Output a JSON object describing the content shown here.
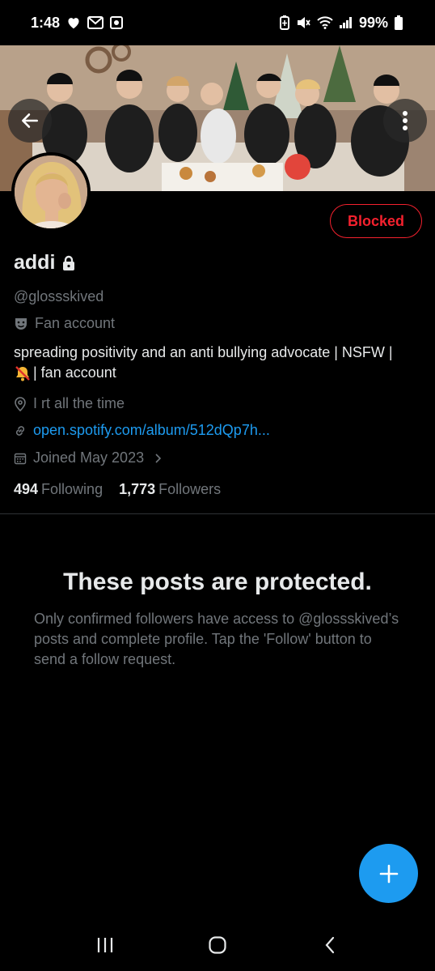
{
  "status_bar": {
    "time": "1:48",
    "battery": "99%",
    "left_icons": [
      "heart-icon",
      "gmail-icon",
      "outlook-icon"
    ],
    "right_icons": [
      "battery-saver-icon",
      "mute-icon",
      "wifi-icon",
      "signal-icon",
      "battery-icon"
    ]
  },
  "profile": {
    "display_name": "addi",
    "handle": "@glossskived",
    "category": "Fan account",
    "bio_line1": "spreading positivity and an anti bullying advocate | NSFW |",
    "bio_line2": "| fan account",
    "location": "I rt all the time",
    "link": "open.spotify.com/album/512dQp7h...",
    "joined": "Joined May 2023",
    "following_count": "494",
    "following_label": "Following",
    "followers_count": "1,773",
    "followers_label": "Followers",
    "blocked_label": "Blocked"
  },
  "protected": {
    "title": "These posts are protected.",
    "body": "Only confirmed followers have access to @glossskived’s posts and complete profile. Tap the 'Follow' button to send a follow request."
  },
  "colors": {
    "accent": "#1d9bf0",
    "blocked": "#f4212e",
    "muted_text": "#71767b",
    "primary_text": "#e7e9ea"
  }
}
